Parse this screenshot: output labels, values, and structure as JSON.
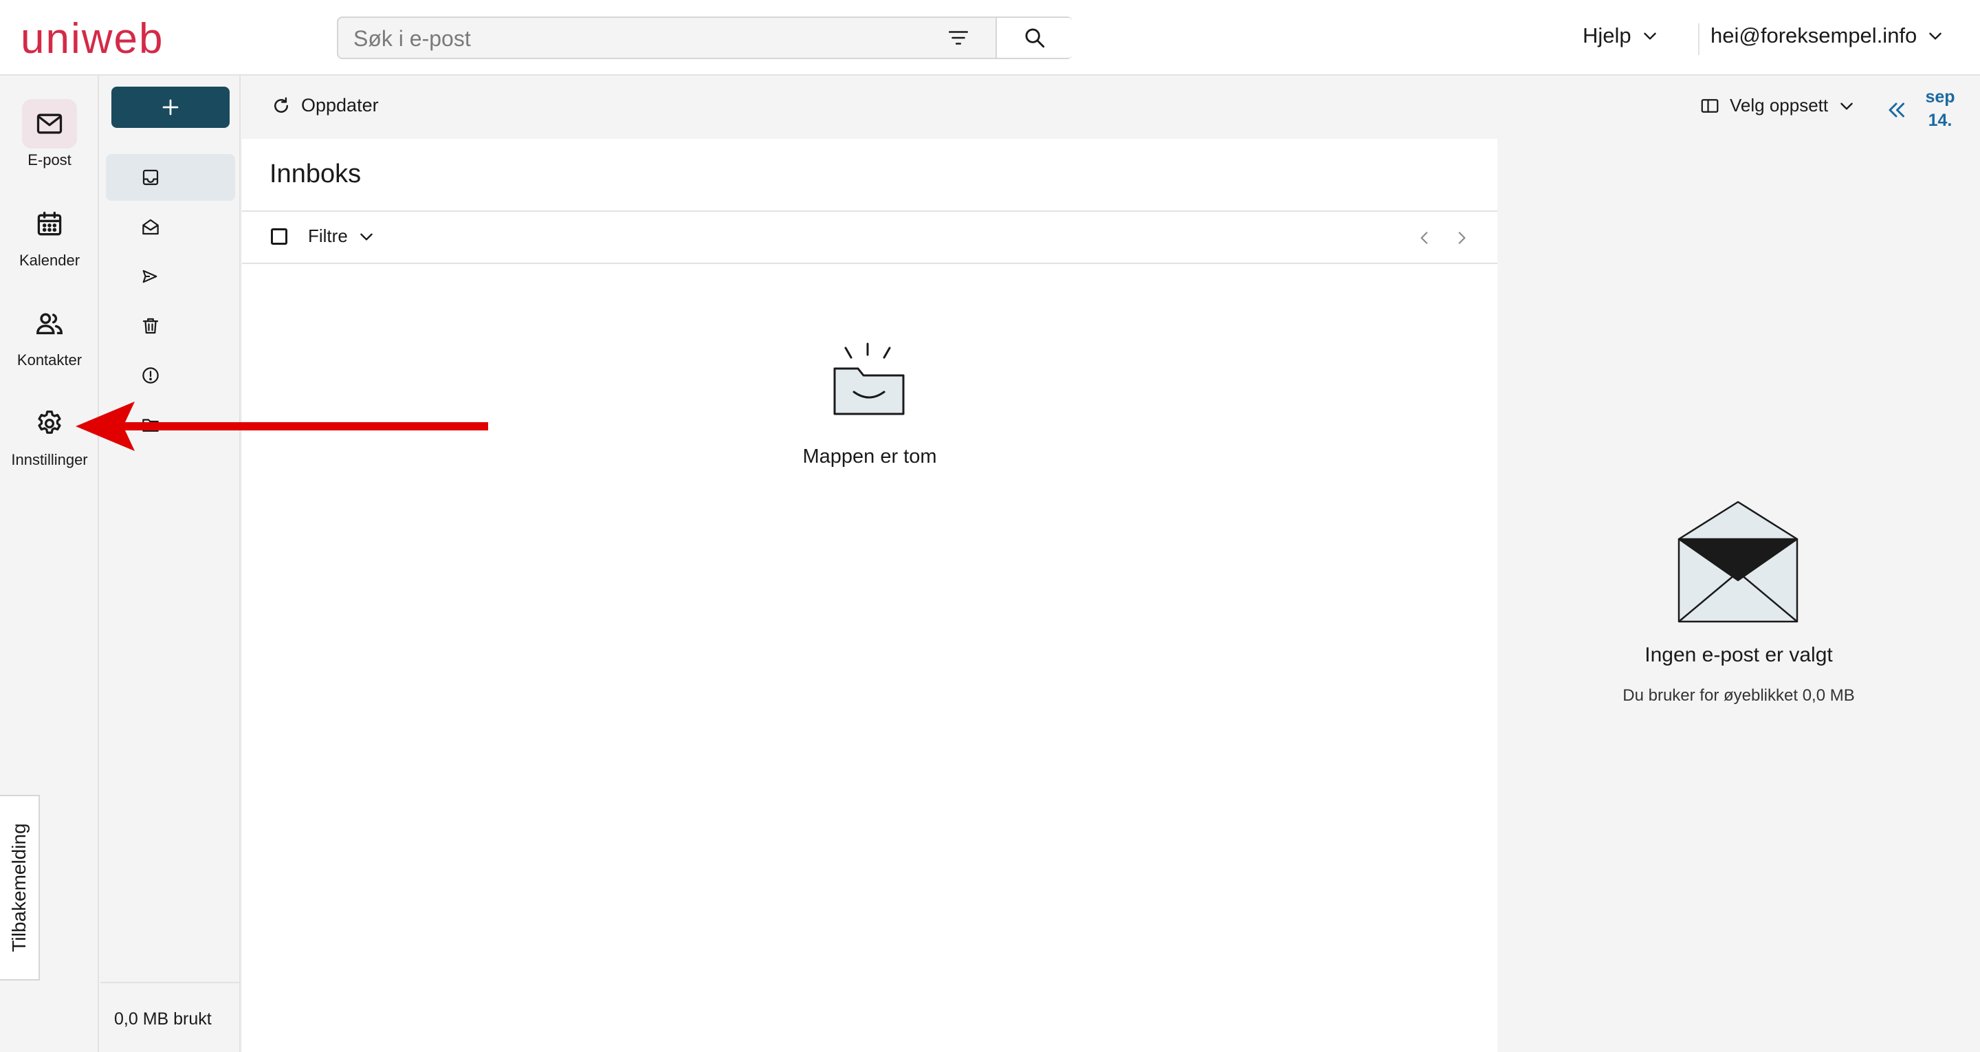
{
  "app": {
    "logo_text": "uniweb",
    "brand_color": "#d42a47",
    "accent_color": "#1a4a5e"
  },
  "header": {
    "search_placeholder": "Søk i e-post",
    "help_label": "Hjelp",
    "account_email": "hei@foreksempel.info",
    "icons": {
      "filter": "filter-lines-icon",
      "search": "magnifier-icon",
      "dropdown": "chevron-down-icon"
    }
  },
  "nav_rail": {
    "items": [
      {
        "label": "E-post",
        "icon": "envelope-icon",
        "active": true
      },
      {
        "label": "Kalender",
        "icon": "calendar-icon",
        "active": false
      },
      {
        "label": "Kontakter",
        "icon": "contacts-icon",
        "active": false
      },
      {
        "label": "Innstillinger",
        "icon": "gear-icon",
        "active": false
      }
    ],
    "feedback_label": "Tilbakemelding"
  },
  "folders": {
    "compose_icon": "plus-icon",
    "items": [
      {
        "icon": "inbox-tray-icon",
        "active": true
      },
      {
        "icon": "open-envelope-icon",
        "active": false
      },
      {
        "icon": "send-icon",
        "active": false
      },
      {
        "icon": "trash-icon",
        "active": false
      },
      {
        "icon": "alert-circle-icon",
        "active": false
      },
      {
        "icon": "folder-icon",
        "active": false
      }
    ],
    "storage_used": "0,0 MB brukt"
  },
  "toolbar": {
    "refresh_label": "Oppdater",
    "layout_label": "Velg oppsett",
    "date_month": "sep",
    "date_day": "14."
  },
  "message_list": {
    "title": "Innboks",
    "filter_label": "Filtre",
    "empty_text": "Mappen er tom"
  },
  "reading_pane": {
    "title": "Ingen e-post er valgt",
    "subtitle": "Du bruker for øyeblikket 0,0 MB"
  },
  "annotation": {
    "arrow_color": "#e00000"
  }
}
